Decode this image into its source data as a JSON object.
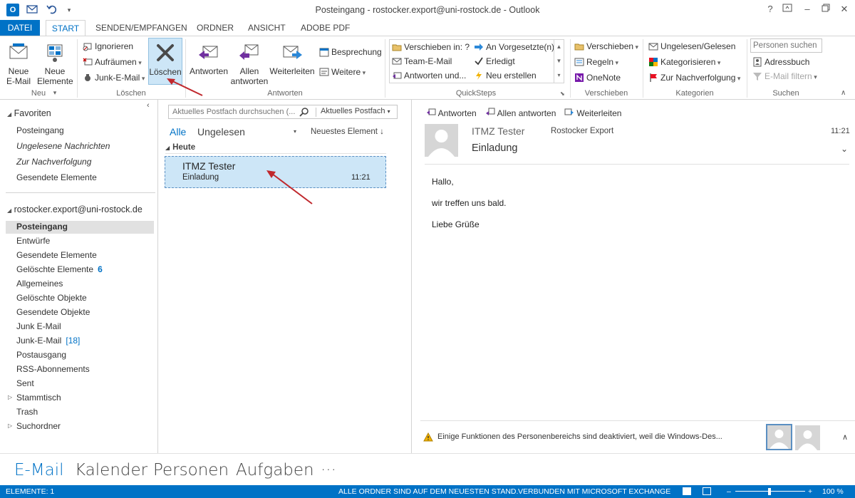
{
  "window": {
    "title": "Posteingang - rostocker.export@uni-rostock.de - Outlook",
    "app_icon": "O"
  },
  "tabs": [
    "DATEI",
    "START",
    "SENDEN/EMPFANGEN",
    "ORDNER",
    "ANSICHT",
    "ADOBE PDF"
  ],
  "ribbon": {
    "neu": {
      "new_email": [
        "Neue",
        "E-Mail"
      ],
      "new_items": [
        "Neue",
        "Elemente"
      ],
      "label": "Neu"
    },
    "loeschen": {
      "ignore": "Ignorieren",
      "cleanup": "Aufräumen",
      "junk": "Junk-E-Mail",
      "delete": "Löschen",
      "label": "Löschen"
    },
    "antworten": {
      "reply": "Antworten",
      "reply_all": [
        "Allen",
        "antworten"
      ],
      "forward": "Weiterleiten",
      "meeting": "Besprechung",
      "more": "Weitere",
      "label": "Antworten"
    },
    "quicksteps": {
      "items": [
        [
          "Verschieben in: ?",
          "An Vorgesetzte(n)"
        ],
        [
          "Team-E-Mail",
          "Erledigt"
        ],
        [
          "Antworten und...",
          "Neu erstellen"
        ]
      ],
      "label": "QuickSteps"
    },
    "verschieben": {
      "move": "Verschieben",
      "rules": "Regeln",
      "onenote": "OneNote",
      "label": "Verschieben"
    },
    "kategorien": {
      "unread": "Ungelesen/Gelesen",
      "categorize": "Kategorisieren",
      "followup": "Zur Nachverfolgung",
      "label": "Kategorien"
    },
    "suchen": {
      "people_search": "Personen suchen",
      "addressbook": "Adressbuch",
      "filter": "E-Mail filtern",
      "label": "Suchen"
    }
  },
  "nav": {
    "favorites_title": "Favoriten",
    "favorites": [
      "Posteingang",
      "Ungelesene Nachrichten",
      "Zur Nachverfolgung",
      "Gesendete Elemente"
    ],
    "account": "rostocker.export@uni-rostock.de",
    "folders": [
      {
        "name": "Posteingang",
        "count": ""
      },
      {
        "name": "Entwürfe",
        "count": ""
      },
      {
        "name": "Gesendete Elemente",
        "count": ""
      },
      {
        "name": "Gelöschte Elemente",
        "count": "6"
      },
      {
        "name": "Allgemeines",
        "count": ""
      },
      {
        "name": "Gelöschte Objekte",
        "count": ""
      },
      {
        "name": "Gesendete Objekte",
        "count": ""
      },
      {
        "name": "Junk E-Mail",
        "count": ""
      },
      {
        "name": "Junk-E-Mail",
        "count": "[18]"
      },
      {
        "name": "Postausgang",
        "count": ""
      },
      {
        "name": "RSS-Abonnements",
        "count": ""
      },
      {
        "name": "Sent",
        "count": ""
      },
      {
        "name": "Stammtisch",
        "count": ""
      },
      {
        "name": "Trash",
        "count": ""
      },
      {
        "name": "Suchordner",
        "count": ""
      }
    ]
  },
  "list": {
    "search_placeholder": "Aktuelles Postfach durchsuchen (...",
    "scope": "Aktuelles Postfach",
    "filter_all": "Alle",
    "filter_unread": "Ungelesen",
    "sort": "Neuestes Element",
    "group": "Heute",
    "messages": [
      {
        "from": "ITMZ Tester",
        "subject": "Einladung",
        "time": "11:21"
      }
    ]
  },
  "reading": {
    "actions": [
      "Antworten",
      "Allen antworten",
      "Weiterleiten"
    ],
    "from": "ITMZ Tester",
    "to": "Rostocker Export",
    "time": "11:21",
    "subject": "Einladung",
    "body": [
      "Hallo,",
      "wir treffen uns bald.",
      "Liebe Grüße"
    ],
    "people_notice": "Einige Funktionen des Personenbereichs sind deaktiviert, weil die Windows-Des..."
  },
  "peeks": [
    "E-Mail",
    "Kalender",
    "Personen",
    "Aufgaben",
    "···"
  ],
  "status": {
    "items": "ELEMENTE: 1",
    "sync": "ALLE ORDNER SIND AUF DEM NEUESTEN STAND.",
    "connection": "VERBUNDEN MIT MICROSOFT EXCHANGE",
    "zoom": "100 %"
  },
  "colors": {
    "accent": "#0072c6",
    "selection": "#cde6f7",
    "annotation_arrow": "#c0282d"
  }
}
